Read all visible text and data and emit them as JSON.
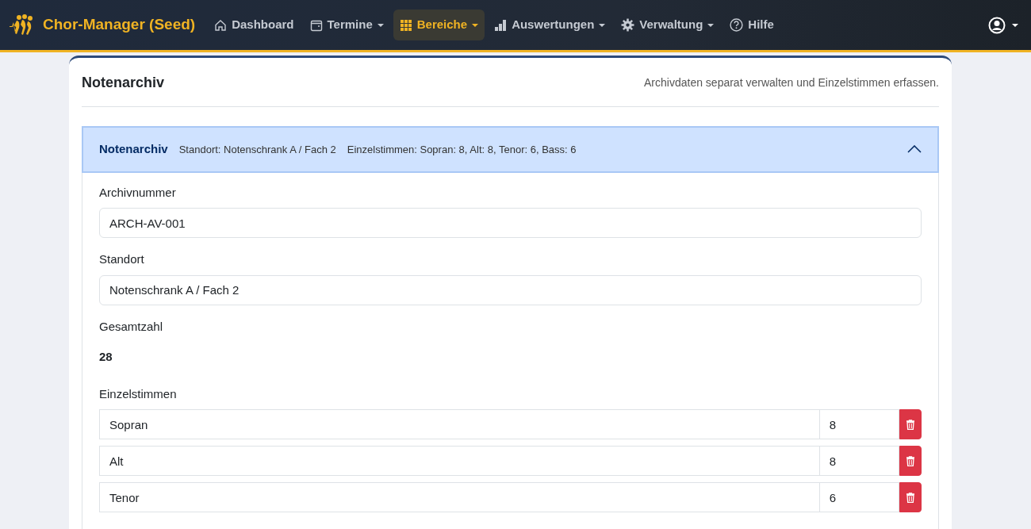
{
  "navbar": {
    "brand": "Chor-Manager (Seed)",
    "items": [
      {
        "label": "Dashboard",
        "dropdown": false,
        "selected": false
      },
      {
        "label": "Termine",
        "dropdown": true,
        "selected": false
      },
      {
        "label": "Bereiche",
        "dropdown": true,
        "selected": true
      },
      {
        "label": "Auswertungen",
        "dropdown": true,
        "selected": false
      },
      {
        "label": "Verwaltung",
        "dropdown": true,
        "selected": false
      },
      {
        "label": "Hilfe",
        "dropdown": false,
        "selected": false
      }
    ]
  },
  "card": {
    "title": "Notenarchiv",
    "subtitle": "Archivdaten separat verwalten und Einzelstimmen erfassen.",
    "accordion": {
      "title": "Notenarchiv",
      "summary_location": "Standort: Notenschrank A / Fach 2",
      "summary_parts": "Einzelstimmen: Sopran: 8, Alt: 8, Tenor: 6, Bass: 6",
      "expanded": true,
      "fields": [
        {
          "label": "Archivnummer",
          "value": "ARCH-AV-001"
        },
        {
          "label": "Standort",
          "value": "Notenschrank A / Fach 2"
        }
      ],
      "total_label": "Gesamtzahl",
      "total": "28",
      "parts_label": "Einzelstimmen",
      "parts": [
        {
          "name": "Sopran",
          "count": "8"
        },
        {
          "name": "Alt",
          "count": "8"
        },
        {
          "name": "Tenor",
          "count": "6"
        }
      ]
    }
  }
}
